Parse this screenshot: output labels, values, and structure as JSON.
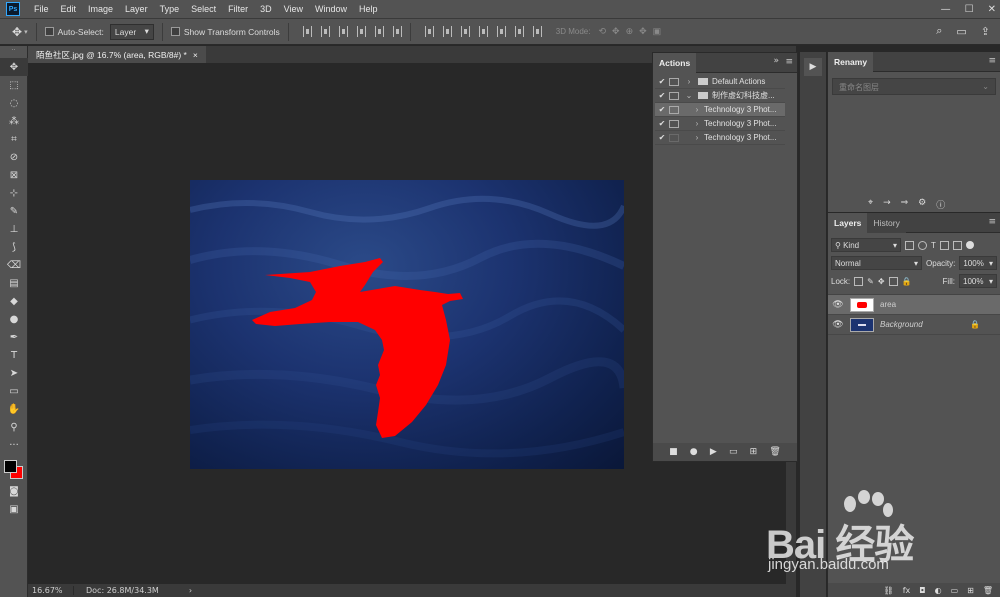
{
  "app": {
    "logo": "Ps"
  },
  "menu": [
    "File",
    "Edit",
    "Image",
    "Layer",
    "Type",
    "Select",
    "Filter",
    "3D",
    "View",
    "Window",
    "Help"
  ],
  "window_controls": [
    "—",
    "☐",
    "✕"
  ],
  "options": {
    "auto_select_label": "Auto-Select:",
    "auto_select_value": "Layer",
    "transform_label": "Show Transform Controls",
    "mode_3d_label": "3D Mode:"
  },
  "document": {
    "tab_title": "陌鱼社区.jpg @ 16.7% (area, RGB/8#) *",
    "close": "×"
  },
  "status": {
    "zoom": "16.67%",
    "doc": "Doc: 26.8M/34.3M",
    "arrow": "›"
  },
  "actions_panel": {
    "title": "Actions",
    "collapse": "»",
    "menu": "≡",
    "rows": [
      {
        "label": "Default Actions",
        "type": "set",
        "expanded": false
      },
      {
        "label": "制作虚幻科技虚...",
        "type": "set",
        "expanded": true
      },
      {
        "label": "Technology 3 Phot...",
        "type": "action",
        "selected": true
      },
      {
        "label": "Technology 3 Phot...",
        "type": "action",
        "selected": false
      },
      {
        "label": "Technology 3 Phot...",
        "type": "action",
        "selected": false
      }
    ],
    "footer": [
      "■",
      "●",
      "▶",
      "▭",
      "⊞",
      "🗑"
    ]
  },
  "renamy": {
    "title": "Renamy",
    "placeholder": "重命名图层",
    "tools": [
      "⌖",
      "→",
      "⇒",
      "⚙",
      "ⓘ"
    ]
  },
  "layers_panel": {
    "tabs": [
      "Layers",
      "History"
    ],
    "filter": "Kind",
    "blend_mode": "Normal",
    "opacity_label": "Opacity:",
    "opacity_value": "100%",
    "lock_label": "Lock:",
    "fill_label": "Fill:",
    "fill_value": "100%",
    "layers": [
      {
        "name": "area",
        "selected": true
      },
      {
        "name": "Background",
        "selected": false,
        "locked": true
      }
    ],
    "footer": [
      "⛓",
      "fx",
      "◘",
      "◐",
      "▭",
      "⊞",
      "🗑"
    ]
  },
  "watermark": {
    "brand": "Bai 经验",
    "url": "jingyan.baidu.com"
  },
  "colors": {
    "fg": "#000000",
    "bg": "#ff0000",
    "accent": "#31a8ff",
    "bird": "#ff0000"
  },
  "tools": [
    "move-tool-icon",
    "marquee-icon",
    "lasso-icon",
    "magic-wand-icon",
    "crop-icon",
    "eyedropper-icon",
    "frame-icon",
    "healing-brush-icon",
    "brush-icon",
    "clone-stamp-icon",
    "history-brush-icon",
    "eraser-icon",
    "gradient-icon",
    "blur-icon",
    "dodge-icon",
    "pen-icon",
    "type-icon",
    "path-select-icon",
    "rectangle-icon",
    "hand-icon",
    "zoom-icon",
    "more-icon"
  ]
}
